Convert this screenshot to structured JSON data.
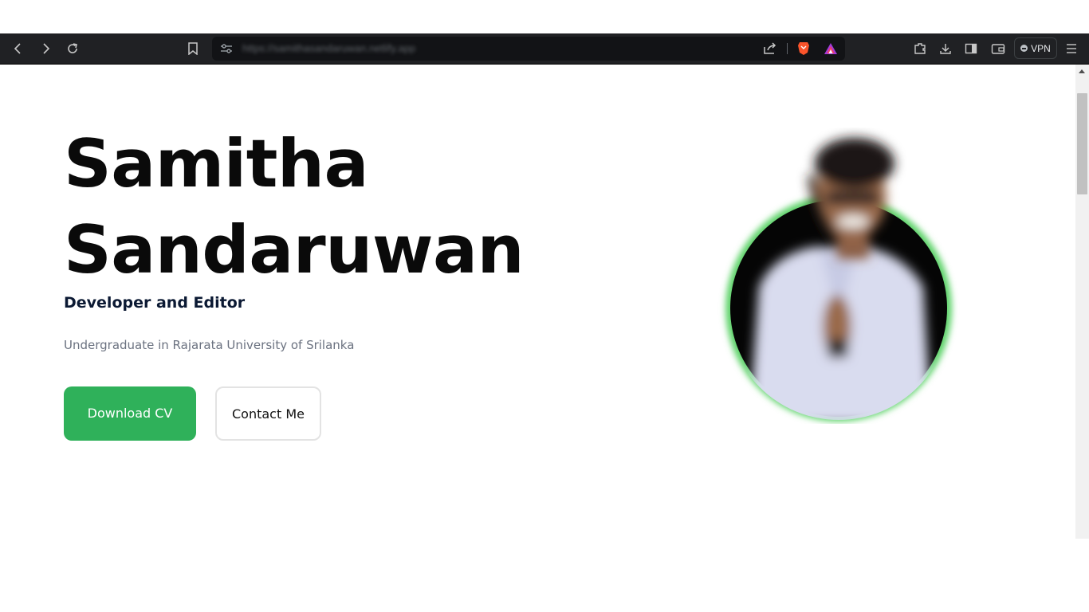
{
  "browser": {
    "url": "https://samithasandaruwan.netlify.app",
    "vpn_label": "VPN"
  },
  "hero": {
    "name_line1": "Samitha",
    "name_line2": "Sandaruwan",
    "role": "Developer and Editor",
    "subtitle": "Undergraduate in Rajarata University of Srilanka",
    "download_cv_label": "Download CV",
    "contact_label": "Contact Me"
  },
  "colors": {
    "toolbar_bg": "#202124",
    "accent_green": "#2fb15a",
    "role_text": "#0b1933"
  }
}
